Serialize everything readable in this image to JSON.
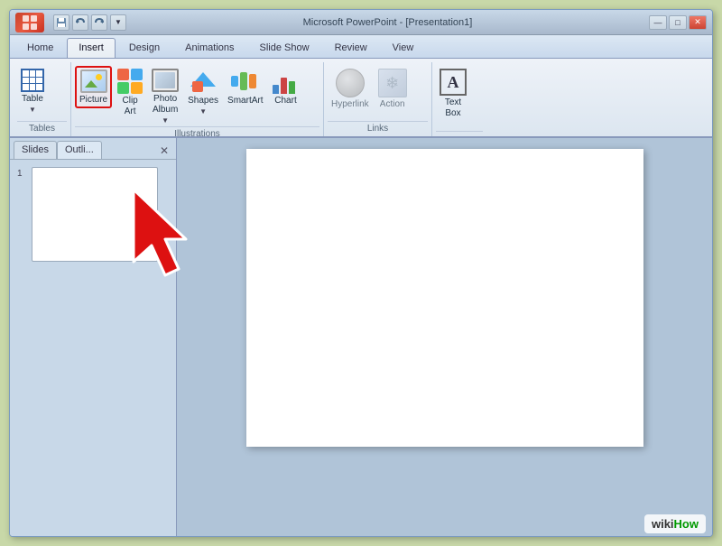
{
  "titlebar": {
    "title": "Microsoft PowerPoint - [Presentation1]",
    "minimize": "—",
    "maximize": "□",
    "close": "✕"
  },
  "quickaccess": {
    "save": "💾",
    "undo": "↩",
    "redo": "↪",
    "dropdown": "▼"
  },
  "tabs": [
    {
      "id": "home",
      "label": "Home"
    },
    {
      "id": "insert",
      "label": "Insert",
      "active": true
    },
    {
      "id": "design",
      "label": "Design"
    },
    {
      "id": "animations",
      "label": "Animations"
    },
    {
      "id": "slideshow",
      "label": "Slide Show"
    },
    {
      "id": "review",
      "label": "Review"
    },
    {
      "id": "view",
      "label": "View"
    }
  ],
  "ribbon": {
    "groups": [
      {
        "id": "tables",
        "label": "Tables",
        "items": [
          {
            "id": "table",
            "label": "Table",
            "hasDropdown": true
          }
        ]
      },
      {
        "id": "illustrations",
        "label": "Illustrations",
        "items": [
          {
            "id": "picture",
            "label": "Picture",
            "highlighted": true
          },
          {
            "id": "clipart",
            "label": "Clip\nArt"
          },
          {
            "id": "photoalbum",
            "label": "Photo\nAlbum",
            "hasDropdown": true
          },
          {
            "id": "shapes",
            "label": "Shapes",
            "hasDropdown": true
          },
          {
            "id": "smartart",
            "label": "SmartArt"
          },
          {
            "id": "chart",
            "label": "Chart"
          }
        ]
      },
      {
        "id": "links",
        "label": "Links",
        "items": [
          {
            "id": "hyperlink",
            "label": "Hyperlink"
          },
          {
            "id": "action",
            "label": "Action"
          }
        ]
      },
      {
        "id": "text",
        "label": "",
        "items": [
          {
            "id": "textbox",
            "label": "Text\nBox"
          }
        ]
      }
    ]
  },
  "slides": {
    "tabs": [
      {
        "id": "slides",
        "label": "Slides",
        "active": true
      },
      {
        "id": "outline",
        "label": "Outli..."
      }
    ],
    "close": "✕",
    "slideNumber": "1"
  },
  "wikihow": {
    "wiki": "wiki",
    "how": "How"
  }
}
